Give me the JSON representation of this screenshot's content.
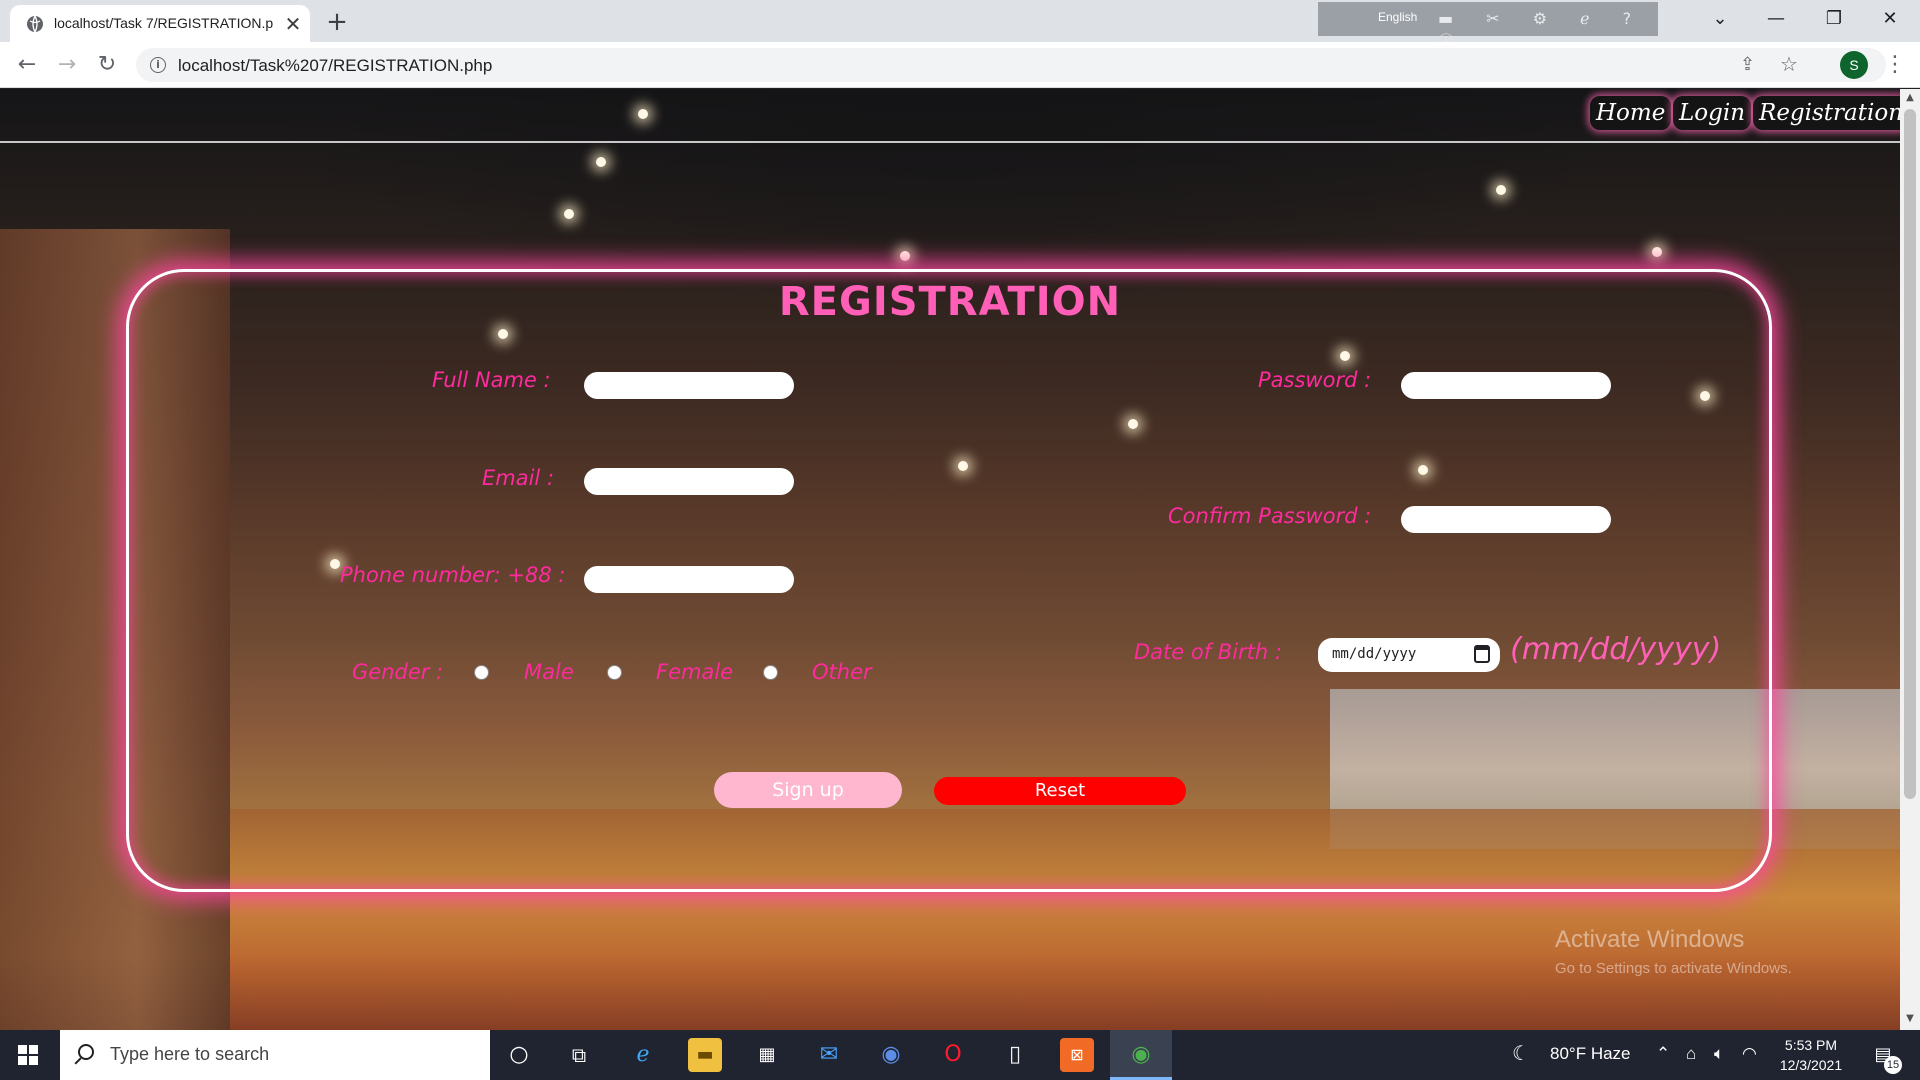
{
  "browser": {
    "tab_title": "localhost/Task 7/REGISTRATION.p",
    "tab_close": "✕",
    "new_tab": "+",
    "language_label": "English",
    "url": "localhost/Task%207/REGISTRATION.php",
    "profile_initial": "S"
  },
  "site_nav": {
    "items": [
      {
        "label": "Home"
      },
      {
        "label": "Login"
      },
      {
        "label": "Registration"
      }
    ]
  },
  "form": {
    "title": "REGISTRATION",
    "full_name_label": "Full Name :",
    "email_label": "Email :",
    "phone_label": "Phone number: +88 :",
    "password_label": "Password :",
    "confirm_password_label": "Confirm Password :",
    "dob_label": "Date of Birth :",
    "dob_placeholder": "mm/dd/yyyy",
    "dob_hint": "(mm/dd/yyyy)",
    "gender_label": "Gender :",
    "gender_options": [
      "Male",
      "Female",
      "Other"
    ],
    "signup_label": "Sign up",
    "reset_label": "Reset"
  },
  "watermark": {
    "line1": "Activate Windows",
    "line2": "Go to Settings to activate Windows."
  },
  "taskbar": {
    "search_placeholder": "Type here to search",
    "weather": "80°F  Haze",
    "time": "5:53 PM",
    "date": "12/3/2021",
    "notification_count": "15"
  },
  "colors": {
    "accent_pink": "#ff2a9d",
    "title_pink": "#ff5fb6",
    "reset_red": "#ff0000",
    "signup_pink": "#ffb6cf"
  }
}
